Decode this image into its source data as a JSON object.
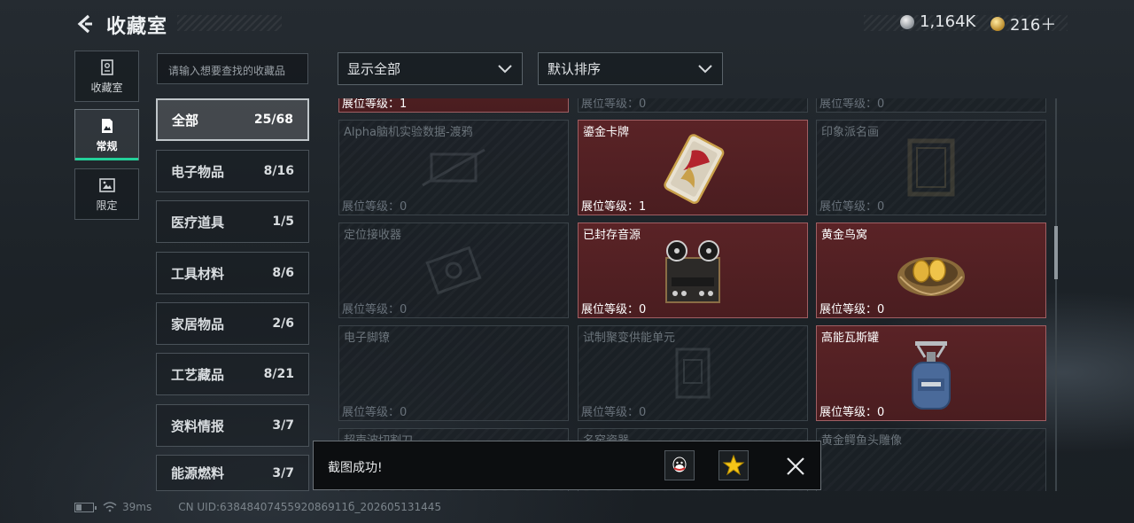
{
  "header": {
    "title": "收藏室",
    "currency": [
      {
        "icon": "silver-coin-icon",
        "value": "1,164K"
      },
      {
        "icon": "gold-coin-icon",
        "value": "216＋"
      }
    ]
  },
  "side_tabs": [
    {
      "label": "收藏室",
      "icon": "collection-room-icon",
      "active": false
    },
    {
      "label": "常规",
      "icon": "regular-icon",
      "active": true
    },
    {
      "label": "限定",
      "icon": "limited-icon",
      "active": false
    }
  ],
  "search": {
    "placeholder": "请输入想要查找的收藏品"
  },
  "categories": [
    {
      "label": "全部",
      "count": "25/68",
      "active": true
    },
    {
      "label": "电子物品",
      "count": "8/16"
    },
    {
      "label": "医疗道具",
      "count": "1/5"
    },
    {
      "label": "工具材料",
      "count": "8/6"
    },
    {
      "label": "家居物品",
      "count": "2/6"
    },
    {
      "label": "工艺藏品",
      "count": "8/21"
    },
    {
      "label": "资料情报",
      "count": "3/7"
    },
    {
      "label": "能源燃料",
      "count": "3/7"
    }
  ],
  "filters": {
    "display": "显示全部",
    "sort": "默认排序"
  },
  "items": [
    {
      "name": "",
      "level": "展位等级：1",
      "owned": true
    },
    {
      "name": "",
      "level": "展位等级：0",
      "owned": false
    },
    {
      "name": "",
      "level": "展位等级：0",
      "owned": false
    },
    {
      "name": "Alpha脑机实验数据-渡鸦",
      "level": "展位等级：0",
      "owned": false
    },
    {
      "name": "鎏金卡牌",
      "level": "展位等级：1",
      "owned": true,
      "art": "gilded-card-icon"
    },
    {
      "name": "印象派名画",
      "level": "展位等级：0",
      "owned": false
    },
    {
      "name": "定位接收器",
      "level": "展位等级：0",
      "owned": false
    },
    {
      "name": "已封存音源",
      "level": "展位等级：0",
      "owned": true,
      "art": "reel-to-reel-icon"
    },
    {
      "name": "黄金鸟窝",
      "level": "展位等级：0",
      "owned": true,
      "art": "golden-nest-icon"
    },
    {
      "name": "电子脚镣",
      "level": "展位等级：0",
      "owned": false
    },
    {
      "name": "试制聚变供能单元",
      "level": "展位等级：0",
      "owned": false
    },
    {
      "name": "高能瓦斯罐",
      "level": "展位等级：0",
      "owned": true,
      "art": "gas-canister-icon"
    },
    {
      "name": "超声波切割刀",
      "level": "",
      "owned": false
    },
    {
      "name": "名窑瓷器",
      "level": "",
      "owned": false
    },
    {
      "name": "黄金鳄鱼头雕像",
      "level": "",
      "owned": false
    }
  ],
  "toast": {
    "message": "截图成功!"
  },
  "footer": {
    "ping": "39ms",
    "uid": "CN UID:6384840745592086911б_202605131445"
  },
  "colors": {
    "accent_green": "#24d19a",
    "owned_card": "#5a2326"
  }
}
